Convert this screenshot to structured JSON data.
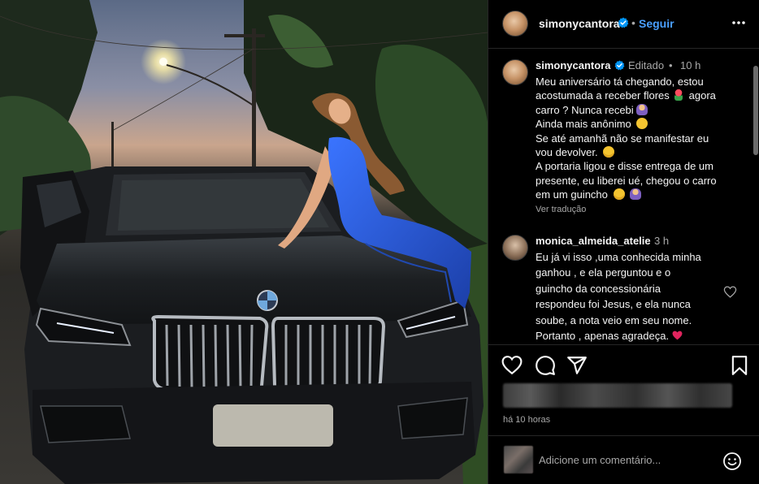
{
  "photo": {
    "description_icon": "photo-bmw-car-woman",
    "license_plate_blurred": true
  },
  "header": {
    "username": "simonycantora",
    "separator": "•",
    "follow_label": "Seguir",
    "more_icon": "more-horizontal-icon",
    "verified_icon": "verified-badge-icon"
  },
  "caption": {
    "username": "simonycantora",
    "edited": "Editado",
    "separator": "•",
    "time": "10 h",
    "lines": [
      "Meu aniversário tá chegando, estou",
      "acostumada a receber flores",
      "agora",
      "carro ? Nunca recebi",
      "Ainda mais anônimo",
      "Se até amanhã não se manifestar eu",
      "vou devolver.",
      "A portaria ligou e disse entrega de um",
      "presente, eu liberei ué, chegou o carro",
      "em um guincho"
    ],
    "translate_label": "Ver tradução"
  },
  "comment": {
    "username": "monica_almeida_atelie",
    "time": "3 h",
    "lines": [
      "Eu já vi isso ,uma conhecida minha",
      "ganhou , e ela perguntou e o",
      "guincho da concessionária",
      "respondeu foi Jesus, e ela nunca",
      "soube, a nota veio em seu nome.",
      "Portanto , apenas agradeça."
    ],
    "like_icon": "heart-outline-icon"
  },
  "actions": {
    "icons": [
      "heart-icon",
      "comment-icon",
      "share-icon",
      "bookmark-icon"
    ],
    "time": "há 10 horas"
  },
  "add_comment": {
    "placeholder": "Adicione um comentário...",
    "emoji_icon": "emoji-icon"
  },
  "colors": {
    "background": "#000000",
    "text": "#f5f5f5",
    "secondary": "#a8a8a8",
    "link_blue": "#4a9fff",
    "verified_blue": "#0095f6",
    "divider": "#262626",
    "car_body": "#1f2224",
    "jumpsuit": "#2b5fd9"
  }
}
